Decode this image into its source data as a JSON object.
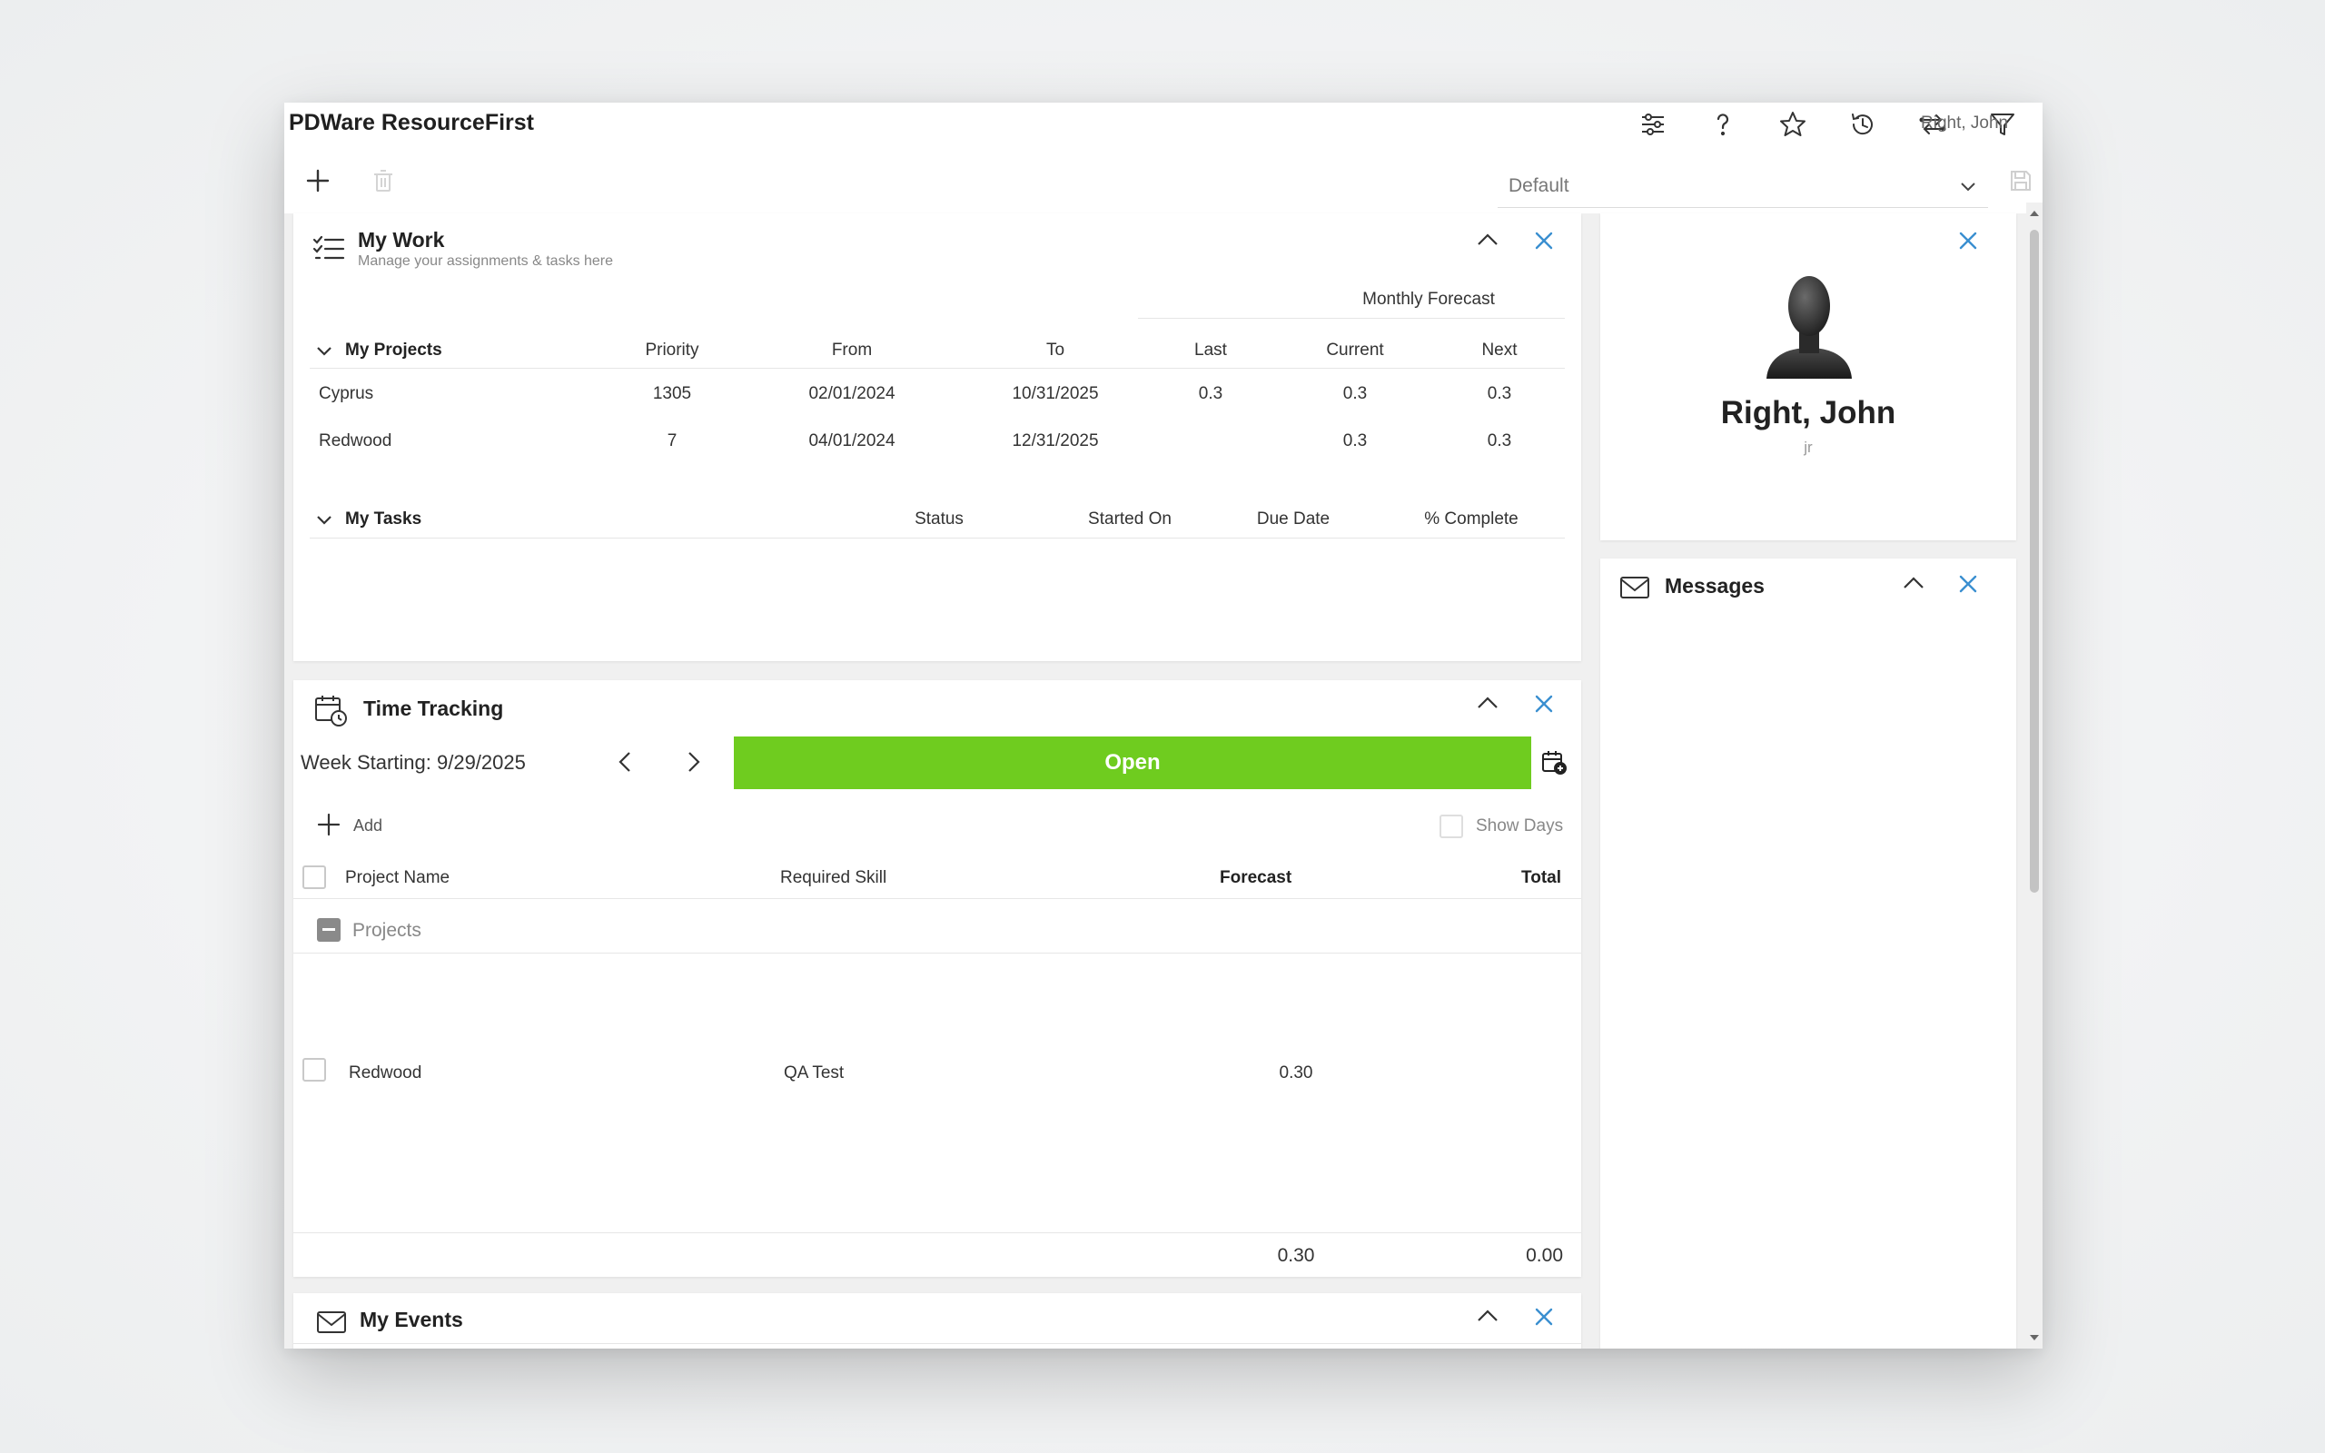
{
  "app": {
    "title": "PDWare ResourceFirst",
    "user_name": "Right, John"
  },
  "top_icons": [
    "sliders-icon",
    "help-icon",
    "star-icon",
    "history-icon",
    "swap-icon",
    "filter-icon",
    "user-icon"
  ],
  "layout_select": {
    "value": "Default"
  },
  "my_work": {
    "title": "My Work",
    "subtitle": "Manage your assignments & tasks here",
    "forecast_group": "Monthly Forecast",
    "projects_header": {
      "name": "My Projects",
      "priority": "Priority",
      "from": "From",
      "to": "To",
      "last": "Last",
      "current": "Current",
      "next": "Next"
    },
    "projects": [
      {
        "name": "Cyprus",
        "priority": "1305",
        "from": "02/01/2024",
        "to": "10/31/2025",
        "last": "0.3",
        "current": "0.3",
        "next": "0.3"
      },
      {
        "name": "Redwood",
        "priority": "7",
        "from": "04/01/2024",
        "to": "12/31/2025",
        "last": "",
        "current": "0.3",
        "next": "0.3"
      }
    ],
    "tasks_header": {
      "name": "My Tasks",
      "status": "Status",
      "started_on": "Started On",
      "due_date": "Due Date",
      "complete": "% Complete"
    }
  },
  "time_tracking": {
    "title": "Time Tracking",
    "week_label": "Week Starting: 9/29/2025",
    "status_button": "Open",
    "status_color": "#6fcc1f",
    "add_label": "Add",
    "show_days_label": "Show Days",
    "columns": {
      "project": "Project Name",
      "skill": "Required Skill",
      "forecast": "Forecast",
      "total": "Total"
    },
    "group": "Projects",
    "rows": [
      {
        "project": "Redwood",
        "skill": "QA Test",
        "forecast": "0.30",
        "total": ""
      }
    ],
    "totals": {
      "forecast": "0.30",
      "total": "0.00"
    }
  },
  "my_events": {
    "title": "My Events"
  },
  "profile": {
    "name": "Right, John",
    "initials": "jr"
  },
  "messages": {
    "title": "Messages"
  },
  "accent_color": "#3a8fd0"
}
